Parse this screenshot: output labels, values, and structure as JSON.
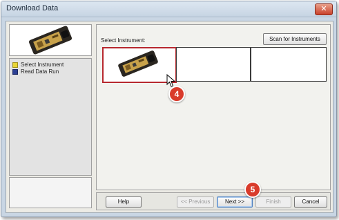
{
  "window": {
    "title": "Download Data",
    "close_symbol": "✕"
  },
  "sidebar": {
    "steps": [
      {
        "label": "Select Instrument",
        "color": "#e8d536"
      },
      {
        "label": "Read Data Run",
        "color": "#2c3f93"
      }
    ]
  },
  "main": {
    "select_label": "Select Instrument:",
    "scan_button_label": "Scan for Instruments",
    "instrument_slots": [
      {
        "icon": "data-logger-icon",
        "selected": true
      },
      {
        "icon": "",
        "selected": false
      },
      {
        "icon": "",
        "selected": false
      }
    ]
  },
  "buttons": {
    "help": "Help",
    "previous": "<< Previous",
    "next": "Next >>",
    "finish": "Finish",
    "cancel": "Cancel"
  },
  "callouts": {
    "step4": "4",
    "step5": "5"
  },
  "colors": {
    "selection_border": "#b7282e",
    "callout": "#d93b2b"
  }
}
